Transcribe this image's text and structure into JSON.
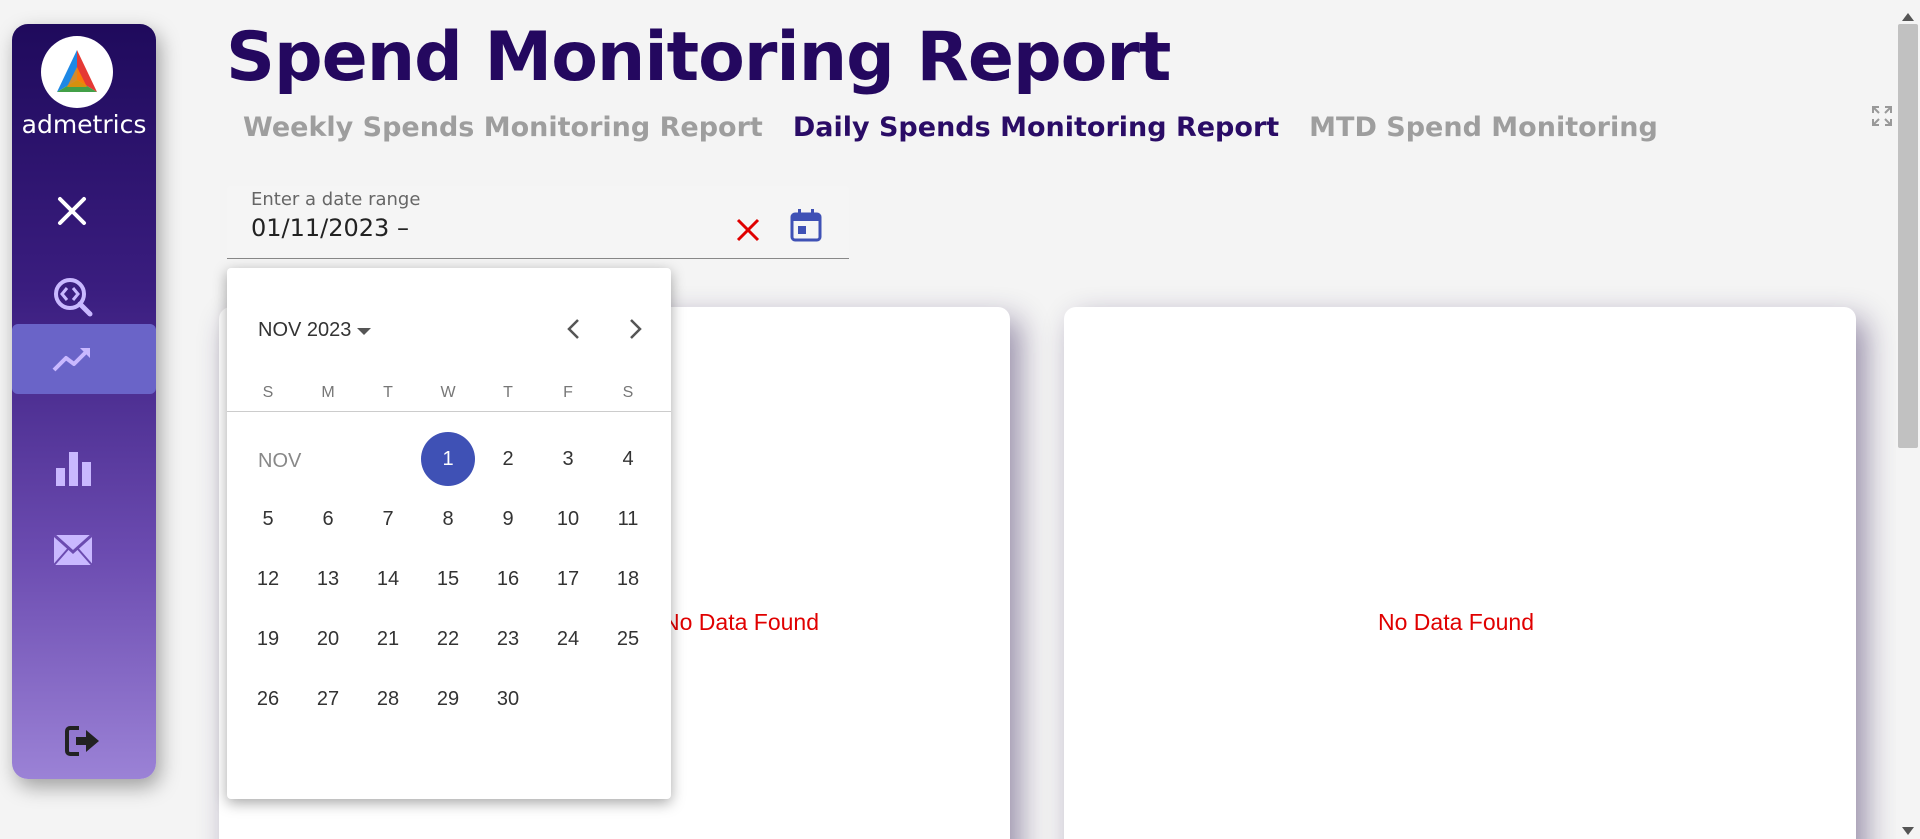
{
  "app": {
    "title": "Spend Monitoring Report",
    "brand": "admetrics"
  },
  "tabs": [
    {
      "label": "Weekly Spends Monitoring Report",
      "active": false
    },
    {
      "label": "Daily Spends Monitoring Report",
      "active": true
    },
    {
      "label": "MTD Spend Monitoring",
      "active": false
    }
  ],
  "sidebar": {
    "items": [
      {
        "icon": "close-icon"
      },
      {
        "icon": "code-search-icon"
      },
      {
        "icon": "trending-up-icon",
        "active": true
      },
      {
        "icon": "bar-chart-icon"
      },
      {
        "icon": "mail-icon"
      },
      {
        "icon": "logout-icon"
      }
    ]
  },
  "date_range": {
    "label": "Enter a date range",
    "value": "01/11/2023 –"
  },
  "calendar": {
    "month_label": "NOV 2023",
    "weekdays": [
      "S",
      "M",
      "T",
      "W",
      "T",
      "F",
      "S"
    ],
    "row_label": "NOV",
    "selected_day": "1",
    "weeks": [
      [
        "",
        "",
        "",
        "1",
        "2",
        "3",
        "4"
      ],
      [
        "5",
        "6",
        "7",
        "8",
        "9",
        "10",
        "11"
      ],
      [
        "12",
        "13",
        "14",
        "15",
        "16",
        "17",
        "18"
      ],
      [
        "19",
        "20",
        "21",
        "22",
        "23",
        "24",
        "25"
      ],
      [
        "26",
        "27",
        "28",
        "29",
        "30",
        "",
        ""
      ]
    ]
  },
  "panels": {
    "left_message": "No Data Found",
    "right_message": "No Data Found"
  },
  "colors": {
    "title": "#24085f",
    "active_tab": "#2a0c66",
    "inactive_tab": "#9e9e9e",
    "selected_day": "#3f51b5",
    "no_data": "#e00000",
    "clear": "#e00000"
  }
}
